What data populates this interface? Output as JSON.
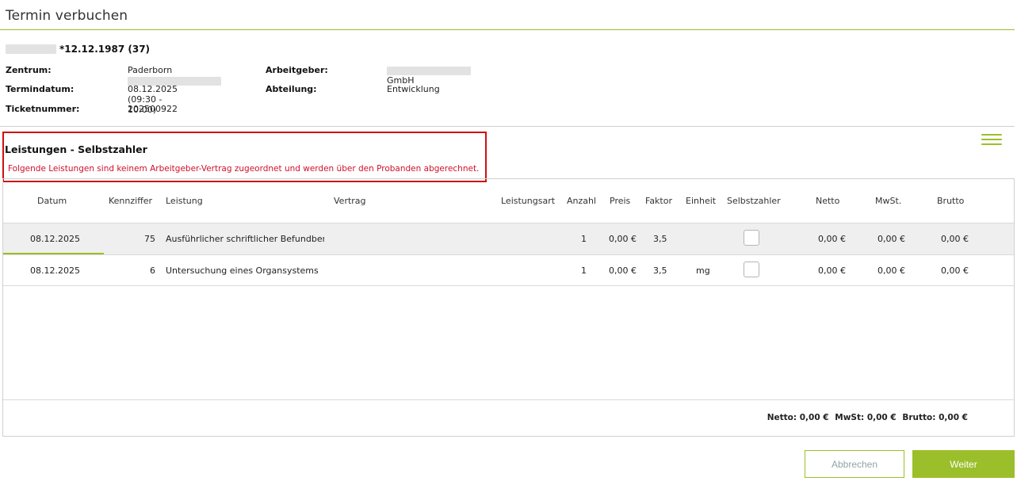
{
  "page": {
    "title": "Termin verbuchen"
  },
  "patient": {
    "birth_line": "*12.12.1987 (37)",
    "labels": {
      "center": "Zentrum:",
      "appointment_date": "Termindatum:",
      "ticket": "Ticketnummer:",
      "employer": "Arbeitgeber:",
      "department": "Abteilung:"
    },
    "values": {
      "center_prefix": "Paderborn",
      "appointment_date": "08.12.2025 (09:30 - 10:00)",
      "ticket": "202500922",
      "employer_suffix": "GmbH",
      "department": "Entwicklung"
    }
  },
  "section": {
    "heading": "Leistungen - Selbstzahler",
    "note": "Folgende Leistungen sind keinem Arbeitgeber-Vertrag zugeordnet und werden über den Probanden abgerechnet."
  },
  "menu": {
    "icon": "hamburger-menu-icon",
    "color": "#9bbf2a"
  },
  "table": {
    "headers": {
      "date": "Datum",
      "code": "Kennziffer",
      "service": "Leistung",
      "contract": "Vertrag",
      "service_type": "Leistungsart",
      "quantity": "Anzahl",
      "price": "Preis",
      "factor": "Faktor",
      "unit": "Einheit",
      "self_payer": "Selbstzahler",
      "net": "Netto",
      "vat": "MwSt.",
      "gross": "Brutto"
    },
    "rows": [
      {
        "date": "08.12.2025",
        "code": "75",
        "service": "Ausführlicher schriftlicher Befundberic",
        "contract": "",
        "service_type": "",
        "quantity": "1",
        "price": "0,00 €",
        "factor": "3,5",
        "unit": "",
        "self_payer": false,
        "net": "0,00 €",
        "vat": "0,00 €",
        "gross": "0,00 €"
      },
      {
        "date": "08.12.2025",
        "code": "6",
        "service": "Untersuchung eines Organsystems",
        "contract": "",
        "service_type": "",
        "quantity": "1",
        "price": "0,00 €",
        "factor": "3,5",
        "unit": "mg",
        "self_payer": false,
        "net": "0,00 €",
        "vat": "0,00 €",
        "gross": "0,00 €"
      }
    ],
    "totals": {
      "net": "Netto: 0,00 €",
      "vat": "MwSt: 0,00 €",
      "gross": "Brutto: 0,00 €"
    }
  },
  "buttons": {
    "cancel": "Abbrechen",
    "next": "Weiter"
  },
  "colors": {
    "accent": "#9bbf2a",
    "alert": "#d10f0f",
    "note_text": "#d0102a"
  }
}
